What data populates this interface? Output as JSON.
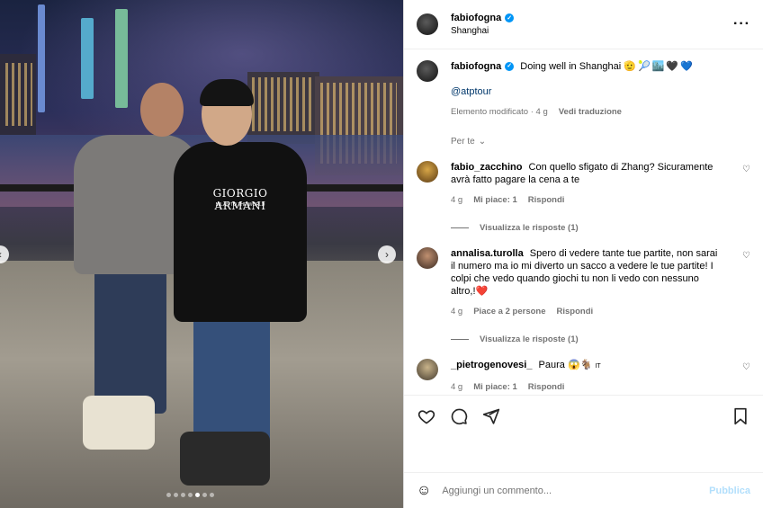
{
  "post": {
    "header": {
      "username": "fabiofogna",
      "location": "Shanghai",
      "more_icon": "more-horizontal-icon"
    },
    "caption": {
      "username": "fabiofogna",
      "text": "Doing well in Shanghai",
      "emojis": [
        "🫡",
        "🎾",
        "🏙️",
        "🖤",
        "💙"
      ],
      "mention": "@atptour",
      "edited_label": "Elemento modificato",
      "time": "4 g",
      "translate_label": "Vedi traduzione"
    },
    "filter_label": "Per te",
    "photo": {
      "shirt_brand": "GIORGIO ARMANI",
      "shirt_subtext": "MILAN TO THE WORLD",
      "carousel_total": 7,
      "carousel_active": 5
    },
    "comments": [
      {
        "username": "fabio_zacchino",
        "text": "Con quello sfigato di Zhang? Sicuramente avrà fatto pagare la cena a te",
        "time": "4 g",
        "likes": "Mi piace: 1",
        "reply_label": "Rispondi",
        "view_replies": "Visualizza le risposte (1)"
      },
      {
        "username": "annalisa.turolla",
        "text": "Spero di vedere tante tue partite, non sarai il numero ma io mi diverto un sacco a vedere le tue partite! I colpi che vedo quando giochi tu non li vedo con nessuno altro,!❤️",
        "time": "4 g",
        "likes": "Piace a 2 persone",
        "reply_label": "Rispondi",
        "view_replies": "Visualizza le risposte (1)"
      },
      {
        "username": "_pietrogenovesi_",
        "text": "Paura 😱🐐",
        "flag": "IT",
        "time": "4 g",
        "likes": "Mi piace: 1",
        "reply_label": "Rispondi"
      }
    ],
    "compose": {
      "placeholder": "Aggiungi un commento...",
      "publish_label": "Pubblica"
    }
  },
  "colors": {
    "link": "#00376b",
    "verified": "#0095f6",
    "muted": "#737373",
    "publish": "#b2dffc"
  }
}
